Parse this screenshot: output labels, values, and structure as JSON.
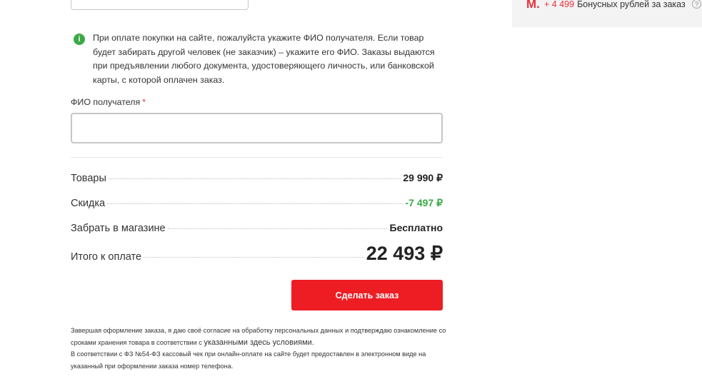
{
  "info": {
    "icon": "info-icon",
    "text": "При оплате покупки на сайте, пожалуйста укажите ФИО получателя. Если товар будет забирать другой человек (не заказчик) – укажите его ФИО. Заказы выдаются при предъявлении любого документа, удостоверяющего личность, или банковской карты, с которой оплачен заказ."
  },
  "recipient": {
    "label": "ФИО получателя",
    "required_mark": "*",
    "value": "",
    "placeholder": ""
  },
  "summary": {
    "goods_label": "Товары",
    "goods_value": "29 990 ₽",
    "discount_label": "Скидка",
    "discount_value": "-7 497 ₽",
    "pickup_label": "Забрать в магазине",
    "pickup_value": "Бесплатно",
    "total_label": "Итого к оплате",
    "total_value": "22 493 ₽"
  },
  "order_button": "Сделать заказ",
  "legal": {
    "line1": "Завершая оформление заказа, я даю своё согласие на обработку персональных данных и подтверждаю ознакомление со сроками хранения товара в соответствии с ",
    "link": "указанными здесь условиями.",
    "line2": "В соответствии с ФЗ №54-ФЗ кассовый чек при онлайн-оплате на сайте будет предоставлен в электронном виде на указанный при оформлении заказа номер телефона."
  },
  "sidebar": {
    "logo_icon": "m-logo-icon",
    "logo_glyph": "M.",
    "bonus_amount": "+ 4 499",
    "bonus_text": "Бонусных рублей за заказ",
    "help_glyph": "?"
  },
  "colors": {
    "accent": "#ee1d24",
    "discount": "#3aa946"
  }
}
